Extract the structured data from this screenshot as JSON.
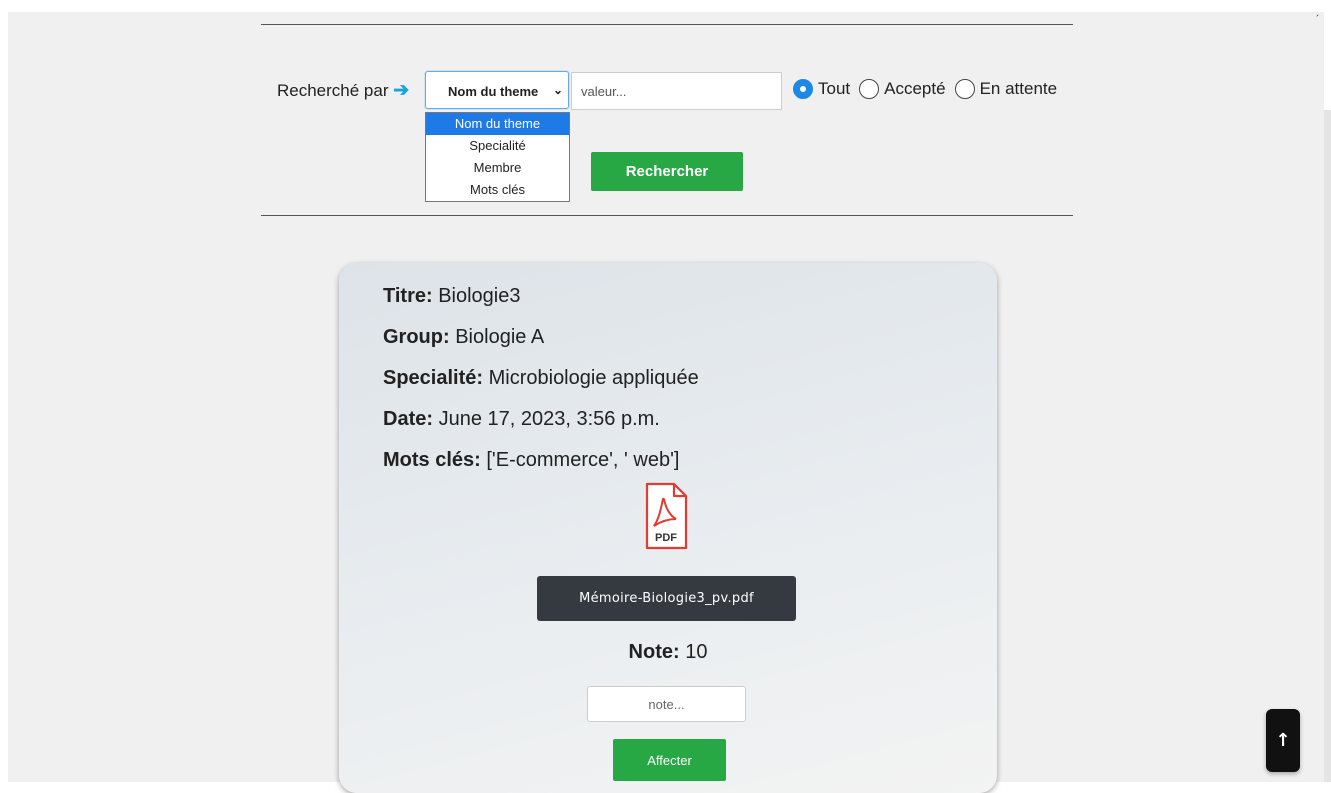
{
  "search": {
    "label": "Recherché par",
    "arrow_glyph": "➔",
    "select_value": "Nom du theme",
    "chevron_glyph": "⌄",
    "options": [
      "Nom du theme",
      "Specialité",
      "Membre",
      "Mots clés"
    ],
    "selected_option_index": 0,
    "value_placeholder": "valeur...",
    "value": "",
    "radios": [
      {
        "label": "Tout",
        "checked": true
      },
      {
        "label": "Accepté",
        "checked": false
      },
      {
        "label": "En attente",
        "checked": false
      }
    ],
    "submit_label": "Rechercher"
  },
  "card": {
    "titre_key": "Titre:",
    "titre_value": "Biologie3",
    "group_key": "Group:",
    "group_value": "Biologie A",
    "specialite_key": "Specialité:",
    "specialite_value": "Microbiologie appliquée",
    "date_key": "Date:",
    "date_value": "June 17, 2023, 3:56 p.m.",
    "mots_key": "Mots clés:",
    "mots_value": "['E-commerce', ' web']",
    "pdf_icon_label": "PDF",
    "file_name": "Mémoire-Biologie3_pv.pdf",
    "note_key": "Note:",
    "note_value": "10",
    "note_placeholder": "note...",
    "assign_label": "Affecter"
  },
  "scroll_top": {
    "glyph": "↑"
  },
  "colors": {
    "accent_green": "#28a745",
    "select_highlight": "#1e7ae6",
    "radio_checked": "#1e88e5",
    "arrow_color": "#1aa3d9",
    "file_button": "#343a40",
    "pdf_red": "#e03c31"
  }
}
